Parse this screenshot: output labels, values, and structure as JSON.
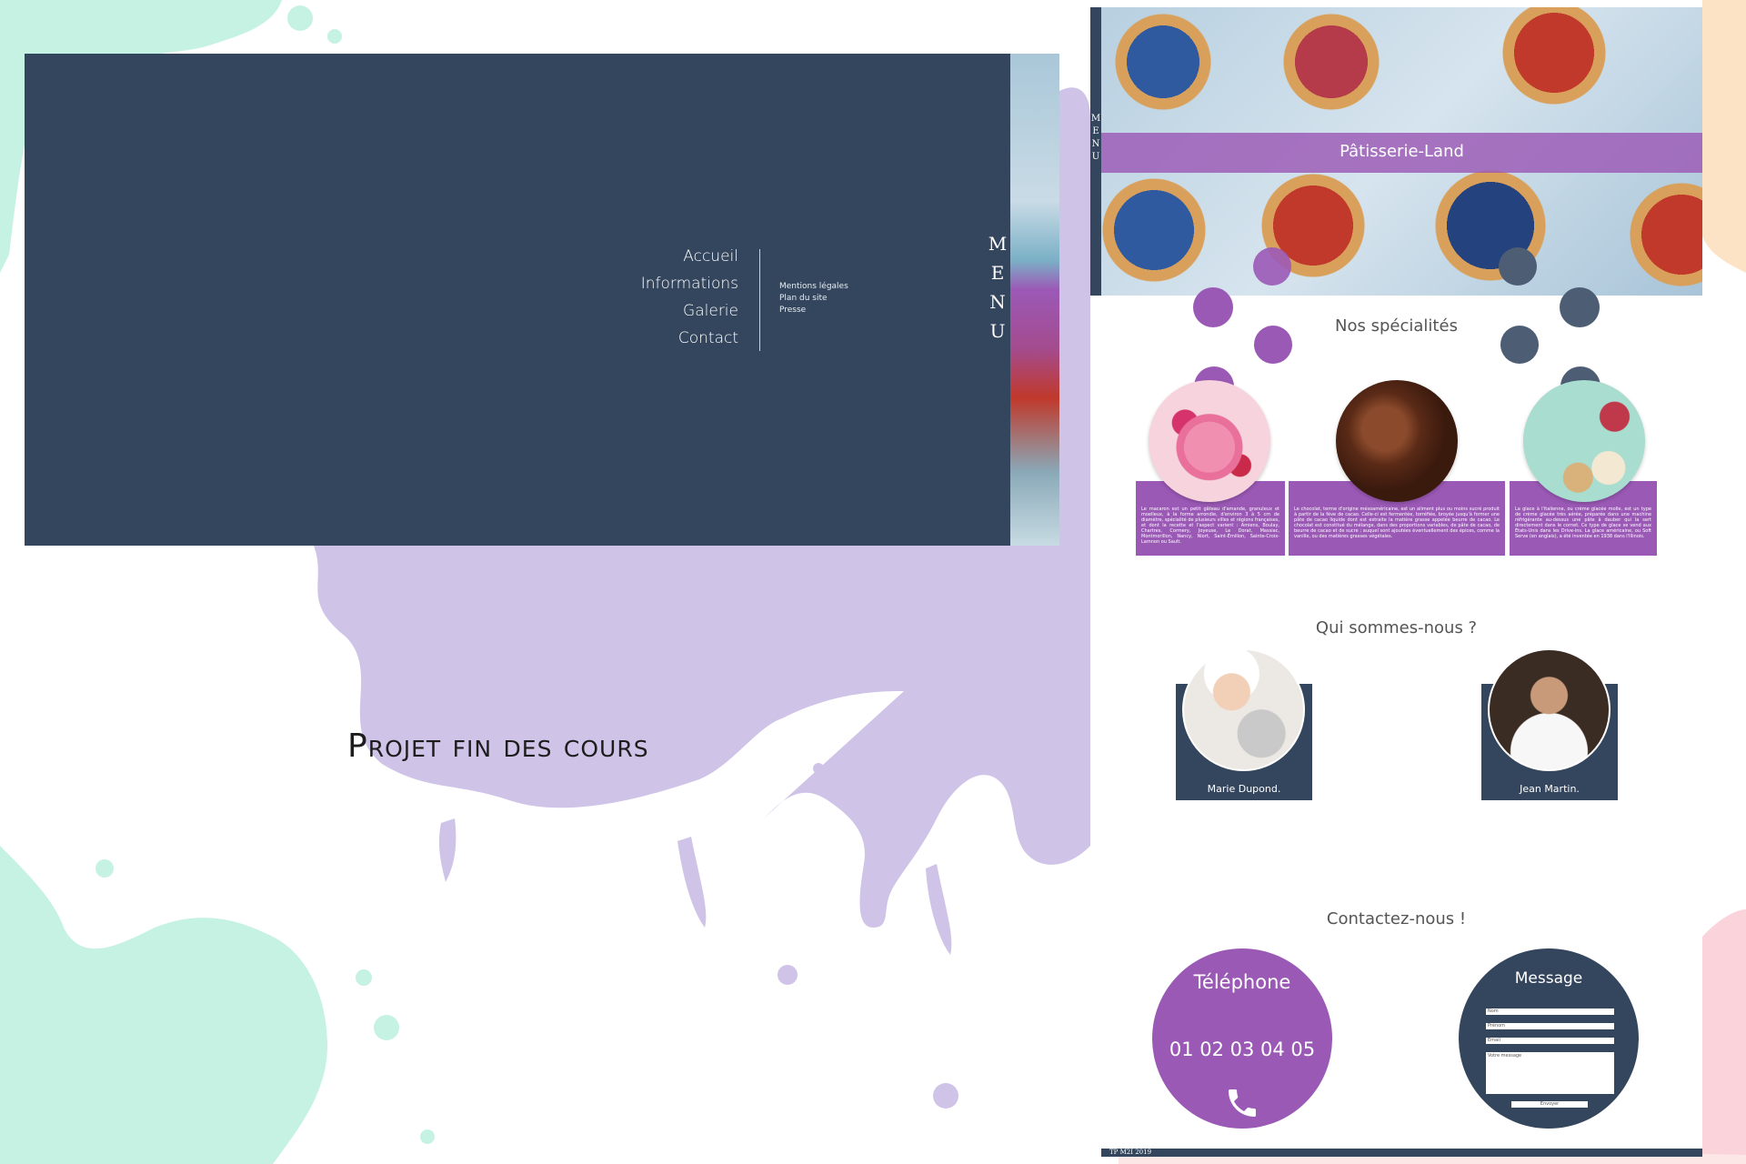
{
  "left_menu": {
    "vertical_title": "MENU",
    "main_links": [
      "Accueil",
      "Informations",
      "Galerie",
      "Contact"
    ],
    "sub_links": [
      "Mentions légales",
      "Plan du site",
      "Presse"
    ]
  },
  "project_title": "Projet fin des cours",
  "site": {
    "hero_title": "Pâtisserie-Land",
    "hero_menu": "MENU",
    "specialties_title": "Nos spécialités",
    "specialties": [
      {
        "image": "macarons-image",
        "text": "Le macaron est un petit gâteau d'amande, granuleux et moelleux, à la forme arrondie, d'environ 3 à 5 cm de diamètre, spécialité de plusieurs villes et régions françaises, et dont la recette et l'aspect varient : Amiens, Boulay, Chartres, Cormery, Joyeuse, Le Dorat, Massiac, Montmorillon, Nancy, Niort, Saint-Émilion, Sainte-Croix-Lamnon ou Sault."
      },
      {
        "image": "chocolate-image",
        "text": "Le chocolat, terme d'origine mésoaméricaine, est un aliment plus ou moins sucré produit à partir de la fève de cacao. Celle-ci est fermentée, torréfiée, broyée jusqu'à former une pâte de cacao liquide dont est extraite la matière grasse appelée beurre de cacao. Le chocolat est constitué du mélange, dans des proportions variables, de pâte de cacao, de beurre de cacao et de sucre ; auquel sont ajoutées éventuellement des épices, comme la vanille, ou des matières grasses végétales."
      },
      {
        "image": "ice-cream-image",
        "text": "La glace à l'italienne, ou crème glacée molle, est un type de crème glacée très aérée, préparée dans une machine réfrigérante au-dessus une pâte à dauber qui la sert directement dans le cornet. Ce type de glace se vend aux États-Unis dans les Drive-ins. La glace américaine, ou Soft Serve (en anglais), a été inventée en 1938 dans l'Illinois."
      }
    ],
    "about_title": "Qui sommes-nous ?",
    "team": [
      {
        "name": "Marie Dupond."
      },
      {
        "name": "Jean Martin."
      }
    ],
    "contact_title": "Contactez-nous !",
    "phone_label": "Téléphone",
    "phone_number": "01 02 03 04 05",
    "message_label": "Message",
    "form": {
      "name_placeholder": "Nom",
      "firstname_placeholder": "Prénom",
      "email_placeholder": "Email",
      "message_placeholder": "Votre message",
      "submit_label": "Envoyer"
    },
    "footer": "TP M2I 2019"
  },
  "colors": {
    "navy": "#34465d",
    "purple": "#9b59b6",
    "lavender_splash": "#cfc3e8",
    "mint_splash": "#c6f2e4"
  }
}
